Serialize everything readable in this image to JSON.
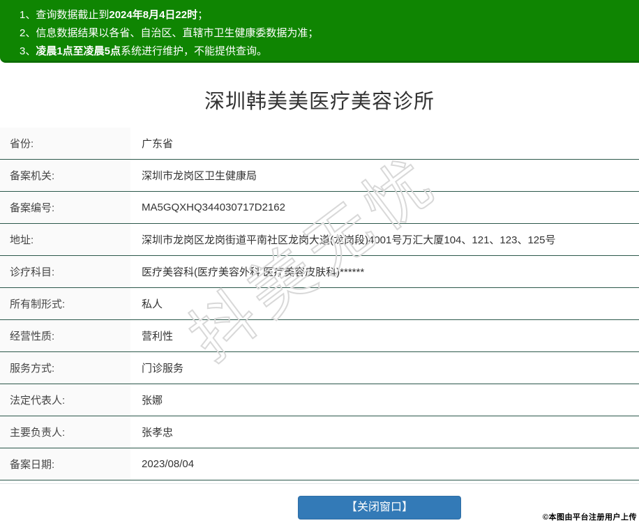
{
  "colors": {
    "banner_green": "#0f8502",
    "banner_green_dark": "#0b6d00",
    "row_border": "#2b574a",
    "label_bg": "#fafafa",
    "button_blue": "#337ab7",
    "watermark_gray": "#d8d8d8"
  },
  "notice": {
    "lines": [
      {
        "num": "1、",
        "pre": "查询数据截止到",
        "bold": "2024年8月4日22时",
        "post": "；"
      },
      {
        "num": "2、",
        "pre": "信息数据结果以各省、自治区、直辖市卫生健康委数据为准；",
        "bold": "",
        "post": ""
      },
      {
        "num": "3、",
        "pre": "",
        "bold": "凌晨1点至凌晨5点",
        "post": "系统进行维护，不能提供查询。"
      }
    ]
  },
  "title": "深圳韩美美医疗美容诊所",
  "table": {
    "rows": [
      {
        "label": "省份:",
        "value": "广东省"
      },
      {
        "label": "备案机关:",
        "value": "深圳市龙岗区卫生健康局"
      },
      {
        "label": "备案编号:",
        "value": "MA5GQXHQ344030717D2162"
      },
      {
        "label": "地址:",
        "value": "深圳市龙岗区龙岗街道平南社区龙岗大道(龙岗段)4001号万汇大厦104、121、123、125号"
      },
      {
        "label": "诊疗科目:",
        "value": "医疗美容科(医疗美容外科 医疗美容皮肤科)******"
      },
      {
        "label": "所有制形式:",
        "value": "私人"
      },
      {
        "label": "经营性质:",
        "value": "营利性"
      },
      {
        "label": "服务方式:",
        "value": "门诊服务"
      },
      {
        "label": "法定代表人:",
        "value": "张娜"
      },
      {
        "label": "主要负责人:",
        "value": "张孝忠"
      },
      {
        "label": "备案日期:",
        "value": "2023/08/04"
      }
    ]
  },
  "watermark": {
    "text": "抖美无忧"
  },
  "footer": {
    "close_button_label": "【关闭窗口】",
    "stamp": "©本图由平台注册用户上传"
  }
}
